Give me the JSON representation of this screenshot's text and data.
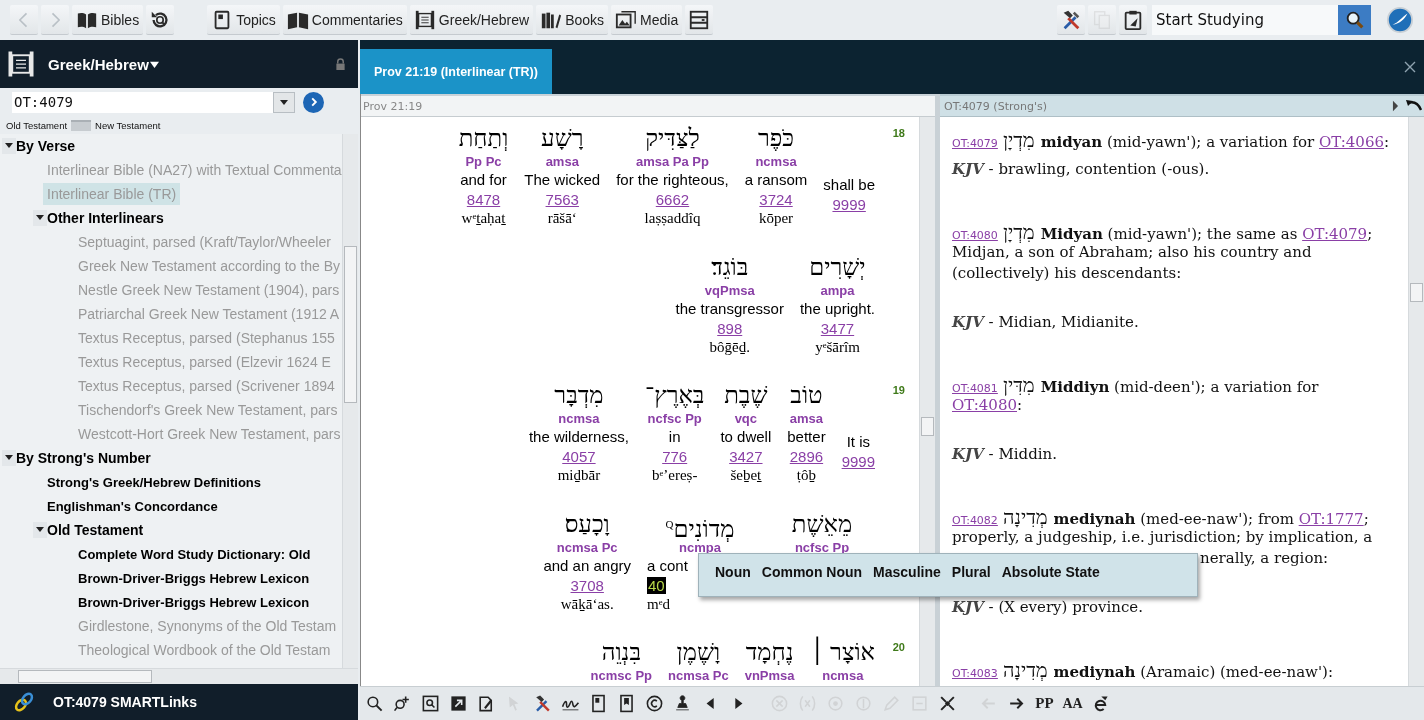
{
  "toolbar": {
    "nav_buttons": [
      {
        "disabled": true
      },
      {
        "disabled": true
      }
    ],
    "library_buttons": [
      {
        "label": "Bibles"
      },
      {
        "label": "Topics"
      },
      {
        "label": "Commentaries"
      },
      {
        "label": "Greek/Hebrew"
      },
      {
        "label": "Books"
      },
      {
        "label": "Media"
      }
    ],
    "tool_buttons": [
      {
        "disabled": false
      },
      {
        "disabled": true
      },
      {
        "disabled": false
      }
    ],
    "search": {
      "value": "Start Studying"
    }
  },
  "sidebar": {
    "title": "Greek/Hebrew",
    "reference": {
      "value": "OT:4079"
    },
    "testaments": {
      "left": "Old Testament",
      "right": "New Testament",
      "on": false
    },
    "tree": [
      {
        "label": "By Verse",
        "expanded": true,
        "selected": false,
        "disabled": false,
        "children": [
          {
            "label": "Interlinear Bible (NA27) with Textual Commenta",
            "selected": false,
            "disabled": true
          },
          {
            "label": "Interlinear Bible (TR)",
            "selected": true,
            "disabled": true
          },
          {
            "label": "Other Interlinears",
            "expanded": true,
            "selected": false,
            "disabled": false,
            "children": [
              {
                "label": "Septuagint, parsed (Kraft/Taylor/Wheeler",
                "selected": false,
                "disabled": true
              },
              {
                "label": "Greek New Testament according to the By",
                "selected": false,
                "disabled": true
              },
              {
                "label": "Nestle Greek New Testament (1904), pars",
                "selected": false,
                "disabled": true
              },
              {
                "label": "Patriarchal Greek New Testament (1912 A",
                "selected": false,
                "disabled": true
              },
              {
                "label": "Textus Receptus, parsed (Stephanus 155",
                "selected": false,
                "disabled": true
              },
              {
                "label": "Textus Receptus, parsed (Elzevir 1624 E",
                "selected": false,
                "disabled": true
              },
              {
                "label": "Textus Receptus, parsed (Scrivener 1894",
                "selected": false,
                "disabled": true
              },
              {
                "label": "Tischendorf's Greek New Testament, pars",
                "selected": false,
                "disabled": true
              },
              {
                "label": "Westcott-Hort Greek New Testament, pars",
                "selected": false,
                "disabled": true
              }
            ]
          }
        ]
      },
      {
        "label": "By Strong's Number",
        "expanded": true,
        "selected": false,
        "disabled": false,
        "children": [
          {
            "label": "Strong's Greek/Hebrew Definitions",
            "selected": false,
            "disabled": false
          },
          {
            "label": "Englishman's Concordance",
            "selected": false,
            "disabled": false
          },
          {
            "label": "Old Testament",
            "expanded": true,
            "selected": false,
            "disabled": false,
            "children": [
              {
                "label": "Complete Word Study Dictionary: Old",
                "selected": false,
                "disabled": false
              },
              {
                "label": "Brown-Driver-Briggs Hebrew Lexicon",
                "selected": false,
                "disabled": false
              },
              {
                "label": "Brown-Driver-Briggs Hebrew Lexicon",
                "selected": false,
                "disabled": false
              },
              {
                "label": "Girdlestone, Synonyms of the Old Testam",
                "selected": false,
                "disabled": true
              },
              {
                "label": "Theological Wordbook of the Old Testam",
                "selected": false,
                "disabled": true
              }
            ]
          }
        ]
      }
    ],
    "footer": "OT:4079 SMARTLinks"
  },
  "tabs": [
    {
      "label": "Prov 21:19 (Interlinear (TR))",
      "selected": true
    }
  ],
  "interlinear": {
    "header": "Prov 21:19",
    "verses": [
      {
        "number": "18",
        "rows": [
          {
            "hebrew_words": [
              "כֹּפֶר",
              "לַצַּדִּיק",
              "רָשָׁע",
              "וְתַחַת"
            ],
            "glosses": [
              {
                "kind": "word",
                "parse": "Pp Pc",
                "english": "and for",
                "strongs": "8478",
                "translit": "wᵉṯaḥaṯ"
              },
              {
                "kind": "word",
                "parse": "amsa",
                "english": "The wicked",
                "strongs": "7563",
                "translit": "rāšāʻ"
              },
              {
                "kind": "word",
                "parse": "amsa Pa Pp",
                "english": "for the righteous,",
                "strongs": "6662",
                "translit": "laṣṣaddîq"
              },
              {
                "kind": "word",
                "parse": "ncmsa",
                "english": "a ransom",
                "strongs": "3724",
                "translit": "kōper"
              },
              {
                "kind": "added",
                "english": "shall be",
                "strongs": "9999"
              }
            ]
          },
          {
            "hebrew_words": [
              "יְשָׁרִים",
              "בּוֹגֵד׃"
            ],
            "glosses": [
              {
                "kind": "word",
                "parse": "vqPmsa",
                "english": "the transgressor",
                "strongs": "898",
                "translit": "bôḡēḏ."
              },
              {
                "kind": "word",
                "parse": "ampa",
                "english": "the upright.",
                "strongs": "3477",
                "translit": "yᵉšārîm"
              }
            ]
          }
        ]
      },
      {
        "number": "19",
        "rows": [
          {
            "hebrew_words": [
              "טוֹב",
              "שֶׁבֶת",
              "בְּאֶרֶץ־",
              "מִדְבָּר"
            ],
            "glosses": [
              {
                "kind": "word",
                "parse": "ncmsa",
                "english": "the wilderness,",
                "strongs": "4057",
                "translit": "miḏbār"
              },
              {
                "kind": "word",
                "parse": "ncfsc Pp",
                "english": "in",
                "strongs": "776",
                "translit": "bᵉʼereṣ-"
              },
              {
                "kind": "word",
                "parse": "vqc",
                "english": "to dwell",
                "strongs": "3427",
                "translit": "šeḇeṯ"
              },
              {
                "kind": "word",
                "parse": "amsa",
                "english": "better",
                "strongs": "2896",
                "translit": "ṭôḇ"
              },
              {
                "kind": "added",
                "english": "It is",
                "strongs": "9999"
              }
            ]
          },
          {
            "hebrew_words": [
              "מֵאֵשֶׁת",
              "מְדוֹנִים$^{Q}$",
              "וָכָעַס׃"
            ],
            "glosses": [
              {
                "kind": "word",
                "parse": "ncmsa Pc",
                "english": "and an angry",
                "strongs": "3708",
                "translit": "wāḵāʻas."
              },
              {
                "kind": "word",
                "parse": "ncmpa",
                "english": "a cont",
                "strongs": "40",
                "strongs_highlighted": true,
                "translit": "mᵉd",
                "covered": true
              },
              {
                "kind": "word",
                "parse": "ncfsc Pp",
                "covered": true
              }
            ]
          }
        ]
      },
      {
        "number": "20",
        "rows": [
          {
            "hebrew_words": [
              "אוֹצָר ׀",
              "נֶחְמָד",
              "וָשֶׁמֶן",
              "בִּנְוֵה"
            ],
            "glosses": [
              {
                "kind": "word",
                "parse": "ncmsc Pp"
              },
              {
                "kind": "word",
                "parse": "ncmsa Pc"
              },
              {
                "kind": "word",
                "parse": "vnPmsa"
              },
              {
                "kind": "word",
                "parse": "ncmsa"
              }
            ]
          }
        ]
      }
    ]
  },
  "tooltip": {
    "terms": [
      "Noun",
      "Common Noun",
      "Masculine",
      "Plural",
      "Absolute State"
    ]
  },
  "strongs_pane": {
    "header": "OT:4079 (Strong's)",
    "entries": [
      {
        "lines": [
          {
            "parts": [
              {
                "kind": "ref",
                "text": "OT:4079"
              },
              {
                "kind": "hebrew",
                "text": "מִדְיָן"
              },
              {
                "kind": "headword",
                "text": "midyan"
              },
              {
                "kind": "text",
                "text": " (mid-yawn'); a variation for "
              },
              {
                "kind": "link",
                "text": "OT:4066"
              },
              {
                "kind": "text",
                "text": ":"
              }
            ]
          }
        ],
        "kjv": "**KJV** - brawling, contention (-ous)."
      },
      {
        "lines": [
          {
            "parts": [
              {
                "kind": "ref",
                "text": "OT:4080"
              },
              {
                "kind": "hebrew",
                "text": "מִדְיָן"
              },
              {
                "kind": "headword",
                "text": "Midyan"
              },
              {
                "kind": "text",
                "text": " (mid-yawn'); the same as "
              },
              {
                "kind": "link",
                "text": "OT:4079"
              },
              {
                "kind": "text",
                "text": ";"
              }
            ]
          },
          {
            "parts": [
              {
                "kind": "text",
                "text": "Midjan, a son of Abraham; also his country and"
              }
            ]
          },
          {
            "parts": [
              {
                "kind": "text",
                "text": "(collectively) his descendants:"
              }
            ]
          }
        ],
        "kjv": "**KJV** - Midian, Midianite."
      },
      {
        "lines": [
          {
            "parts": [
              {
                "kind": "ref",
                "text": "OT:4081"
              },
              {
                "kind": "hebrew",
                "text": "מִדִּין"
              },
              {
                "kind": "headword",
                "text": "Middiyn"
              },
              {
                "kind": "text",
                "text": " (mid-deen'); a variation for"
              }
            ]
          },
          {
            "parts": [
              {
                "kind": "link",
                "text": "OT:4080"
              },
              {
                "kind": "text",
                "text": ":"
              }
            ]
          }
        ],
        "kjv": "**KJV** - Middin."
      },
      {
        "lines": [
          {
            "parts": [
              {
                "kind": "ref",
                "text": "OT:4082"
              },
              {
                "kind": "hebrew",
                "text": "מְדִינָה"
              },
              {
                "kind": "headword",
                "text": "mediynah"
              },
              {
                "kind": "text",
                "text": " (med-ee-naw'); from "
              },
              {
                "kind": "link",
                "text": "OT:1777"
              },
              {
                "kind": "text",
                "text": ";"
              }
            ]
          },
          {
            "parts": [
              {
                "kind": "text",
                "text": "properly, a judgeship, i.e. jurisdiction; by implication, a"
              }
            ]
          },
          {
            "covered": true,
            "parts": [
              {
                "kind": "text",
                "text": "nerally, a region:"
              }
            ]
          }
        ],
        "kjv": "**KJV** - (X every) province."
      },
      {
        "lines": [
          {
            "parts": [
              {
                "kind": "ref",
                "text": "OT:4083"
              },
              {
                "kind": "hebrew",
                "text": "מְדִינָה"
              },
              {
                "kind": "headword",
                "text": "mediynah"
              },
              {
                "kind": "text",
                "text": " (Aramaic) (med-ee-naw'):"
              }
            ]
          }
        ]
      }
    ]
  },
  "bottom_toolbar": [
    {
      "disabled": false
    },
    {
      "disabled": false
    },
    {
      "disabled": false
    },
    {
      "disabled": false
    },
    {
      "disabled": false
    },
    {
      "disabled": true
    },
    {
      "disabled": false
    },
    {
      "disabled": false
    },
    {
      "disabled": false
    },
    {
      "disabled": false
    },
    {
      "disabled": false
    },
    {
      "disabled": false
    },
    {
      "disabled": false
    },
    {
      "disabled": false
    },
    {
      "disabled": true
    },
    {
      "disabled": true
    },
    {
      "disabled": true
    },
    {
      "disabled": true
    },
    {
      "disabled": true
    },
    {
      "disabled": true
    },
    {
      "disabled": false
    },
    {
      "disabled": true
    },
    {
      "disabled": false
    },
    {
      "disabled": false,
      "label": "PP"
    },
    {
      "disabled": false,
      "label": "AA"
    },
    {
      "disabled": false
    }
  ]
}
